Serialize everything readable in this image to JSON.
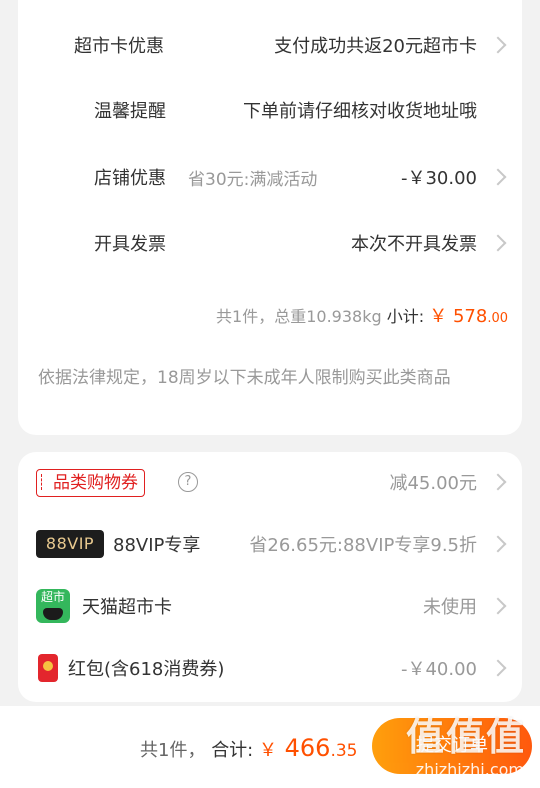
{
  "order_options": [
    {
      "label": "超市卡优惠",
      "value": "支付成功共返20元超市卡"
    },
    {
      "label": "温馨提醒",
      "value": "下单前请仔细核对收货地址哦"
    },
    {
      "label": "店铺优惠",
      "note": "省30元:满减活动",
      "value": "-￥30.00"
    },
    {
      "label": "开具发票",
      "value": "本次不开具发票"
    }
  ],
  "summary": {
    "count_weight": "共1件，总重10.938kg",
    "subtotal_label": "小计:",
    "currency": "￥",
    "subtotal_int": "578",
    "subtotal_dec": ".00"
  },
  "legal_notice": "依据法律规定，18周岁以下未成年人限制购买此类商品",
  "discounts": {
    "category_coupon": {
      "label": "品类购物券",
      "help": "?",
      "value": "减45.00元"
    },
    "vip": {
      "badge": "88VIP",
      "label": "88VIP专享",
      "value": "省26.65元:88VIP专享9.5折"
    },
    "tmall_card": {
      "icon_text": "超市",
      "label": "天猫超市卡",
      "value": "未使用"
    },
    "red_packet": {
      "label": "红包(含618消费券)",
      "value": "-￥40.00"
    }
  },
  "bottom_bar": {
    "count": "共1件，",
    "total_label": "合计:",
    "currency": "￥",
    "total_int": "466",
    "total_dec": ".35",
    "submit": "提交订单"
  },
  "watermark": {
    "logo": "值值值",
    "domain": "zhizhizhi.com"
  },
  "colors": {
    "accent": "#ff5000",
    "coupon_red": "#e02020",
    "background": "#f2f2f2"
  }
}
